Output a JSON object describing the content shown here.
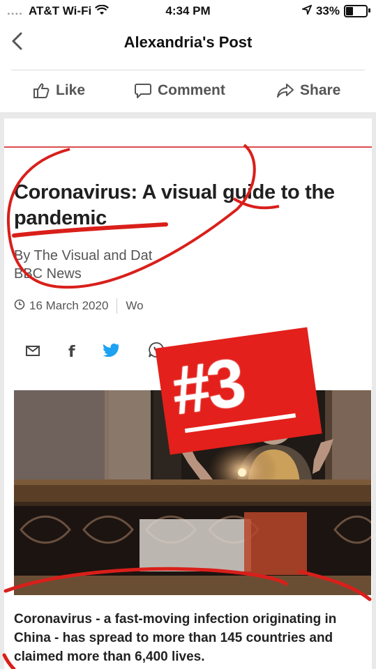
{
  "status": {
    "carrier": "AT&T Wi-Fi",
    "time": "4:34 PM",
    "battery": "33%"
  },
  "nav": {
    "title": "Alexandria's Post"
  },
  "actions": {
    "like": "Like",
    "comment": "Comment",
    "share": "Share"
  },
  "article": {
    "headline": "Coronavirus: A visual guide to the pandemic",
    "byline_1": "By The Visual and Dat",
    "byline_2": "BBC News",
    "date": "16 March 2020",
    "date_extra": "Wo",
    "caption": "Coronavirus - a fast-moving infection originating in China - has spread to more than 145 countries and claimed more than 6,400 lives."
  },
  "overlay": {
    "badge": "#3"
  },
  "colors": {
    "accent_red": "#e3201b",
    "twitter_blue": "#1da1f2"
  }
}
